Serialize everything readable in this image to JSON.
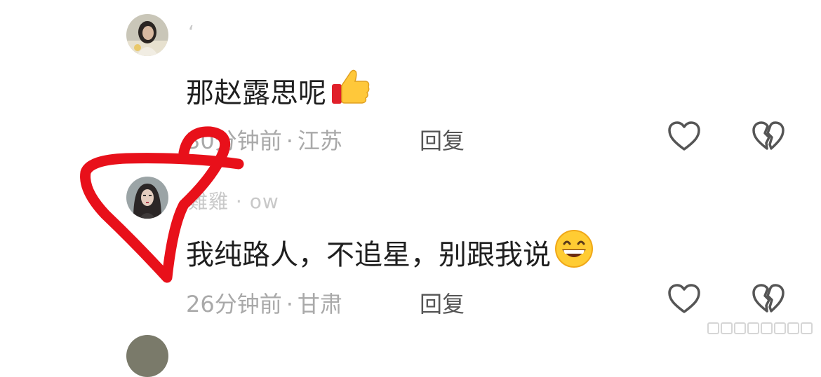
{
  "comments": [
    {
      "username": "ʻ",
      "text": "那赵露思呢",
      "emoji": "thumbs-up-emoji",
      "time": "30分钟前",
      "location": "江苏",
      "separator": "·",
      "reply_label": "回复"
    },
    {
      "username": "雞雞 ·  ow",
      "text": "我纯路人，不追星，别跟我说",
      "emoji": "grinning-face-emoji",
      "time": "26分钟前",
      "location": "甘肃",
      "separator": "·",
      "reply_label": "回复"
    }
  ],
  "icons": {
    "like": "heart-outline-icon",
    "dislike": "broken-heart-icon"
  },
  "colors": {
    "annotation_red": "#e8101a",
    "meta_gray": "#a9a9a9",
    "text": "#1f1f1f"
  }
}
